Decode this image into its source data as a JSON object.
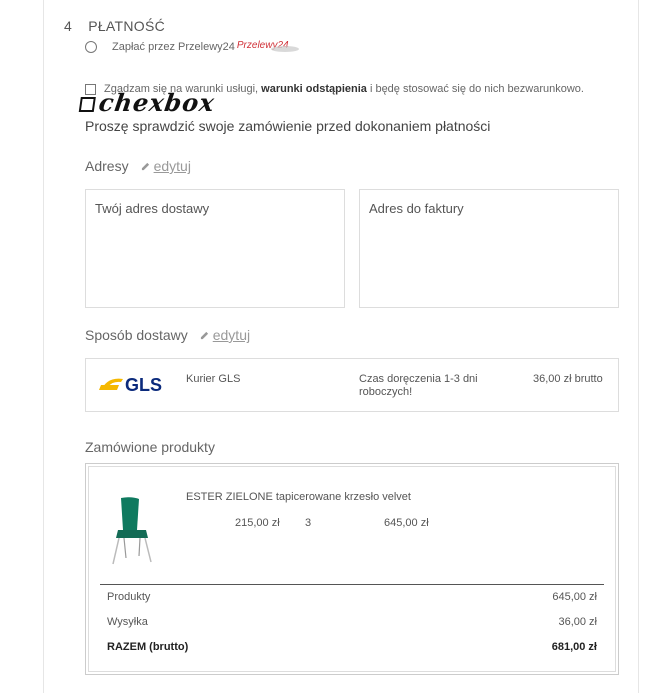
{
  "step": {
    "number": "4",
    "title": "PŁATNOŚĆ"
  },
  "payment": {
    "option_label": "Zapłać przez Przelewy24",
    "logo_text": "Przelewy24"
  },
  "terms": {
    "prefix": "Zgadzam się na warunki usługi, ",
    "bold": "warunki odstąpienia",
    "suffix": " i będę stosować się do nich bezwarunkowo."
  },
  "annotation": {
    "text": "chexbox"
  },
  "verify_text": "Proszę sprawdzić swoje zamówienie przed dokonaniem płatności",
  "addresses": {
    "title": "Adresy",
    "edit_label": "edytuj",
    "shipping_label": "Twój adres dostawy",
    "billing_label": "Adres do faktury"
  },
  "shipping": {
    "title": "Sposób dostawy",
    "edit_label": "edytuj",
    "carrier_logo": "GLS",
    "carrier": "Kurier GLS",
    "time": "Czas doręczenia 1-3 dni roboczych!",
    "price": "36,00 zł brutto"
  },
  "products": {
    "title": "Zamówione produkty",
    "items": [
      {
        "name": "ESTER ZIELONE tapicerowane krzesło velvet",
        "unit_price": "215,00 zł",
        "qty": "3",
        "total": "645,00 zł"
      }
    ]
  },
  "summary": {
    "products_label": "Produkty",
    "products_value": "645,00 zł",
    "shipping_label": "Wysyłka",
    "shipping_value": "36,00 zł",
    "total_label": "RAZEM (brutto)",
    "total_value": "681,00 zł"
  },
  "colors": {
    "accent_red": "#d13239",
    "gls_blue": "#0b2a7c",
    "gls_yellow": "#f5b800",
    "chair_green": "#0f7a5f"
  }
}
